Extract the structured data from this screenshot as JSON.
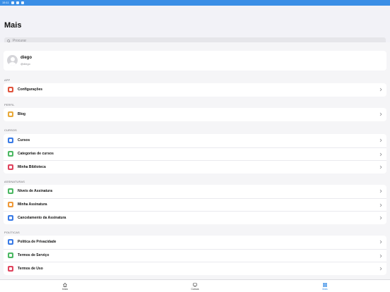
{
  "status_bar": {
    "time": "15:11"
  },
  "header": {
    "title": "Mais",
    "search_placeholder": "Procurar"
  },
  "profile": {
    "name": "diego",
    "handle": "@diego"
  },
  "sections": [
    {
      "label": "APP",
      "items": [
        {
          "label": "Configurações",
          "icon": "gear-icon",
          "color": "#e0543d"
        }
      ]
    },
    {
      "label": "PERFIL",
      "items": [
        {
          "label": "Blog",
          "icon": "blog-icon",
          "color": "#e8a93a"
        }
      ]
    },
    {
      "label": "CURSOS",
      "items": [
        {
          "label": "Cursos",
          "icon": "chat-icon",
          "color": "#3a7be6"
        },
        {
          "label": "Categorias de cursos",
          "icon": "categories-icon",
          "color": "#4cb863"
        },
        {
          "label": "Minha Biblioteca",
          "icon": "bookmark-icon",
          "color": "#e0445e"
        }
      ]
    },
    {
      "label": "ASSINATURAS",
      "items": [
        {
          "label": "Níveis de Assinatura",
          "icon": "user-icon",
          "color": "#4cb863"
        },
        {
          "label": "Minha Assinatura",
          "icon": "user-icon",
          "color": "#ef9a3a"
        },
        {
          "label": "Cancelamento da Assinatura",
          "icon": "user-icon",
          "color": "#3a7be6"
        }
      ]
    },
    {
      "label": "POLÍTICAS",
      "items": [
        {
          "label": "Política de Privacidade",
          "icon": "document-icon",
          "color": "#3a7be6"
        },
        {
          "label": "Termos de Serviço",
          "icon": "document-icon",
          "color": "#4cb863"
        },
        {
          "label": "Termos de Uso",
          "icon": "document-icon",
          "color": "#e0445e"
        }
      ]
    }
  ],
  "tabbar": {
    "tabs": [
      {
        "label": "Início",
        "icon": "home-icon"
      },
      {
        "label": "Cursos",
        "icon": "courses-icon"
      },
      {
        "label": "Mais",
        "icon": "grid-icon",
        "active": true
      }
    ]
  },
  "colors": {
    "accent": "#3a8ee6"
  }
}
